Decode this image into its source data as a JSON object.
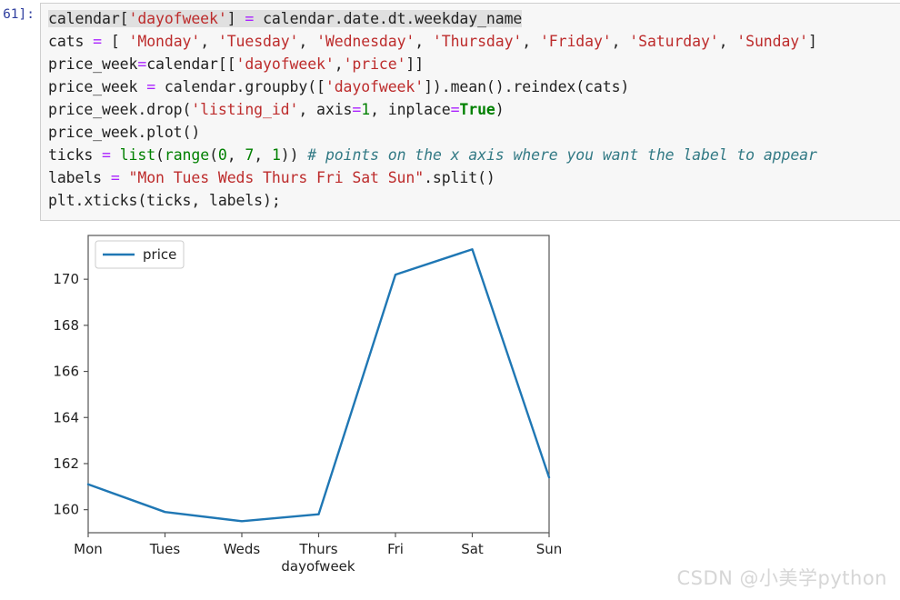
{
  "notebook": {
    "prompt": "61]:",
    "code_lines": [
      "calendar['dayofweek'] = calendar.date.dt.weekday_name",
      "cats = [ 'Monday', 'Tuesday', 'Wednesday', 'Thursday', 'Friday', 'Saturday', 'Sunday']",
      "price_week=calendar[['dayofweek','price']]",
      "price_week = calendar.groupby(['dayofweek']).mean().reindex(cats)",
      "price_week.drop('listing_id', axis=1, inplace=True)",
      "price_week.plot()",
      "ticks = list(range(0, 7, 1)) # points on the x axis where you want the label to appear",
      "labels = \"Mon Tues Weds Thurs Fri Sat Sun\".split()",
      "plt.xticks(ticks, labels);"
    ],
    "tokens": {
      "line1": {
        "a": "calendar",
        "b": "[",
        "c": "'dayofweek'",
        "d": "]",
        "e": " = ",
        "f": "calendar.date.dt.weekday_name"
      },
      "line2": {
        "a": "cats ",
        "b": "=",
        "c": " [ ",
        "d": "'Monday'",
        "e": ", ",
        "f": "'Tuesday'",
        "g": ", ",
        "h": "'Wednesday'",
        "i": ", ",
        "j": "'Thursday'",
        "k": ", ",
        "l": "'Friday'",
        "m": ", ",
        "n": "'Saturday'",
        "o": ", ",
        "p": "'Sunday'",
        "q": "]"
      },
      "line3": {
        "a": "price_week",
        "b": "=",
        "c": "calendar[[",
        "d": "'dayofweek'",
        "e": ",",
        "f": "'price'",
        "g": "]]"
      },
      "line4": {
        "a": "price_week ",
        "b": "=",
        "c": " calendar.groupby([",
        "d": "'dayofweek'",
        "e": "]).mean().reindex(cats)"
      },
      "line5": {
        "a": "price_week.drop(",
        "b": "'listing_id'",
        "c": ", axis",
        "d": "=",
        "e": "1",
        "f": ", inplace",
        "g": "=",
        "h": "True",
        "i": ")"
      },
      "line6": {
        "a": "price_week.plot()"
      },
      "line7": {
        "a": "ticks ",
        "b": "=",
        "c": " ",
        "d": "list",
        "e": "(",
        "f": "range",
        "g": "(",
        "h": "0",
        "i": ", ",
        "j": "7",
        "k": ", ",
        "l": "1",
        "m": ")) ",
        "n": "# points on the x axis where you want the label to appear"
      },
      "line8": {
        "a": "labels ",
        "b": "=",
        "c": " ",
        "d": "\"Mon Tues Weds Thurs Fri Sat Sun\"",
        "e": ".split()"
      },
      "line9": {
        "a": "plt.xticks(ticks, labels);"
      }
    }
  },
  "chart_data": {
    "type": "line",
    "title": "",
    "xlabel": "dayofweek",
    "ylabel": "",
    "categories": [
      "Mon",
      "Tues",
      "Weds",
      "Thurs",
      "Fri",
      "Sat",
      "Sun"
    ],
    "series": [
      {
        "name": "price",
        "color": "#1f77b4",
        "values": [
          161.1,
          159.9,
          159.5,
          159.8,
          170.2,
          171.3,
          161.4
        ]
      }
    ],
    "yticks": [
      160,
      162,
      164,
      166,
      168,
      170
    ],
    "ylim": [
      159.0,
      171.9
    ],
    "xlim": [
      0,
      6
    ],
    "grid": false,
    "legend": {
      "position": "upper-left",
      "entries": [
        "price"
      ]
    }
  },
  "watermark": {
    "text": "CSDN @小美学python"
  }
}
